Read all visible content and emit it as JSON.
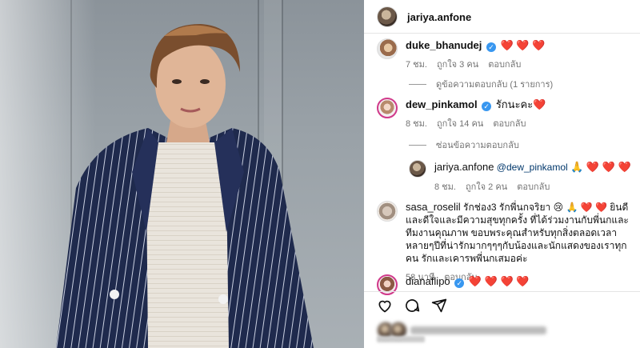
{
  "post": {
    "author": "jariya.anfone"
  },
  "comments": [
    {
      "user": "duke_bhanudej",
      "verified": true,
      "text": "❤️ ❤️ ❤️",
      "time": "7 ชม.",
      "likes": "ถูกใจ 3 คน",
      "reply": "ตอบกลับ",
      "thread_label": "ดูข้อความตอบกลับ (1 รายการ)"
    },
    {
      "user": "dew_pinkamol",
      "verified": true,
      "text": "รักนะคะ❤️",
      "time": "8 ชม.",
      "likes": "ถูกใจ 14 คน",
      "reply": "ตอบกลับ",
      "thread_label": "ซ่อนข้อความตอบกลับ",
      "replies": [
        {
          "user": "jariya.anfone",
          "mention": "@dew_pinkamol",
          "text": "🙏 ❤️ ❤️ ❤️",
          "time": "8 ชม.",
          "likes": "ถูกใจ 2 คน",
          "reply": "ตอบกลับ"
        }
      ]
    },
    {
      "user": "sasa_roselil",
      "verified": false,
      "text": "รักช่อง3 รักพี่นกจริยา 😢 🙏 ❤️ ❤️ ยินดีและดีใจและมีความสุขทุกครั้ง ที่ได้ร่วมงานกับพี่นกและทีมงานคุณภาพ ขอบพระคุณสำหรับทุกสิ่งตลอดเวลาหลายๆปีที่น่ารักมากๆๆๆกับน้องและนักแสดงของเราทุกคน รักและเคารพพี่นกเสมอค่ะ",
      "time": "58 นาที",
      "reply": "ตอบกลับ"
    },
    {
      "user": "dianaflipo",
      "verified": true,
      "text": "❤️ ❤️ ❤️ ❤️"
    }
  ],
  "icons": {
    "like": "heart-outline-icon",
    "comment": "comment-bubble-icon",
    "share": "paper-plane-icon"
  },
  "colors": {
    "verified": "#3897f0",
    "heart": "#e0245e",
    "muted": "#737373"
  }
}
